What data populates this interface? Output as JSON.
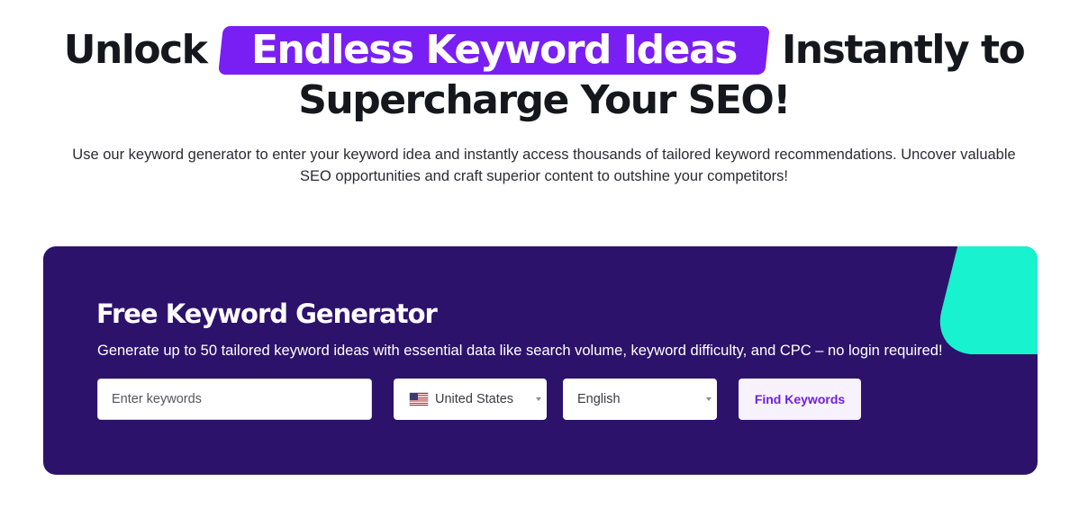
{
  "hero": {
    "title_before": "Unlock",
    "title_highlight": "Endless Keyword Ideas",
    "title_after": "Instantly to",
    "title_line2": "Supercharge Your SEO!",
    "subtitle": "Use our keyword generator to enter your keyword idea and instantly access thousands of tailored keyword recommendations. Uncover valuable SEO opportunities and craft superior content to outshine your competitors!"
  },
  "tool": {
    "title": "Free Keyword Generator",
    "subtitle": "Generate up to 50 tailored keyword ideas with essential data like search volume, keyword difficulty, and CPC – no login required!",
    "keyword_input": {
      "placeholder": "Enter keywords",
      "value": ""
    },
    "country_select": {
      "selected": "United States",
      "flag_icon": "us-flag-icon"
    },
    "language_select": {
      "selected": "English"
    },
    "find_button_label": "Find Keywords"
  },
  "colors": {
    "highlight": "#7a1ff4",
    "panel_background": "#2d126b",
    "accent_shape": "#19f2cf",
    "button_text": "#6f1fe0",
    "button_background": "#f7f2fd"
  }
}
